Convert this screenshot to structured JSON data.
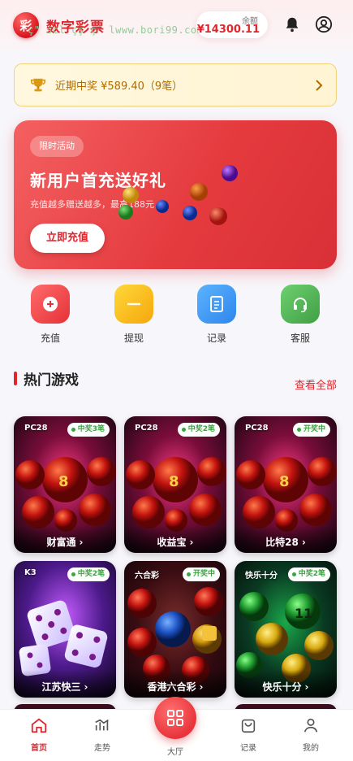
{
  "header": {
    "logo_char": "彩",
    "title": "数字彩票",
    "watermark": "ç\" scl çş ç˜ lwww.bori99.com",
    "balance_label": "余额",
    "balance_value": "¥14300.11"
  },
  "notice": {
    "text": "近期中奖 ¥589.40（9笔）"
  },
  "promo": {
    "tag": "限时活动",
    "title": "新用户首充送好礼",
    "subtitle": "充值越多赠送越多，最高188元",
    "button": "立即充值"
  },
  "quick_actions": [
    {
      "label": "充值",
      "icon": "plus-circle-icon",
      "color": "#ef4a4e"
    },
    {
      "label": "提现",
      "icon": "minus-icon",
      "color": "#f9b514"
    },
    {
      "label": "记录",
      "icon": "document-icon",
      "color": "#3a95f1"
    },
    {
      "label": "客服",
      "icon": "headset-icon",
      "color": "#4caf50"
    }
  ],
  "section": {
    "title": "热门游戏",
    "view_all": "查看全部"
  },
  "games": [
    {
      "type": "PC28",
      "badge": "中奖3笔",
      "name": "财富通"
    },
    {
      "type": "PC28",
      "badge": "中奖2笔",
      "name": "收益宝"
    },
    {
      "type": "PC28",
      "badge": "开奖中",
      "name": "比特28"
    },
    {
      "type": "K3",
      "badge": "中奖2笔",
      "name": "江苏快三"
    },
    {
      "type": "六合彩",
      "badge": "开奖中",
      "name": "香港六合彩"
    },
    {
      "type": "快乐十分",
      "badge": "中奖2笔",
      "name": "快乐十分"
    }
  ],
  "bottom_nav": [
    {
      "label": "首页",
      "active": true
    },
    {
      "label": "走势",
      "active": false
    },
    {
      "label": "大厅",
      "active": false
    },
    {
      "label": "记录",
      "active": false
    },
    {
      "label": "我的",
      "active": false
    }
  ],
  "colors": {
    "brand_red": "#e0262d",
    "win_green": "#3aa53f",
    "notice_text": "#b06c00"
  }
}
